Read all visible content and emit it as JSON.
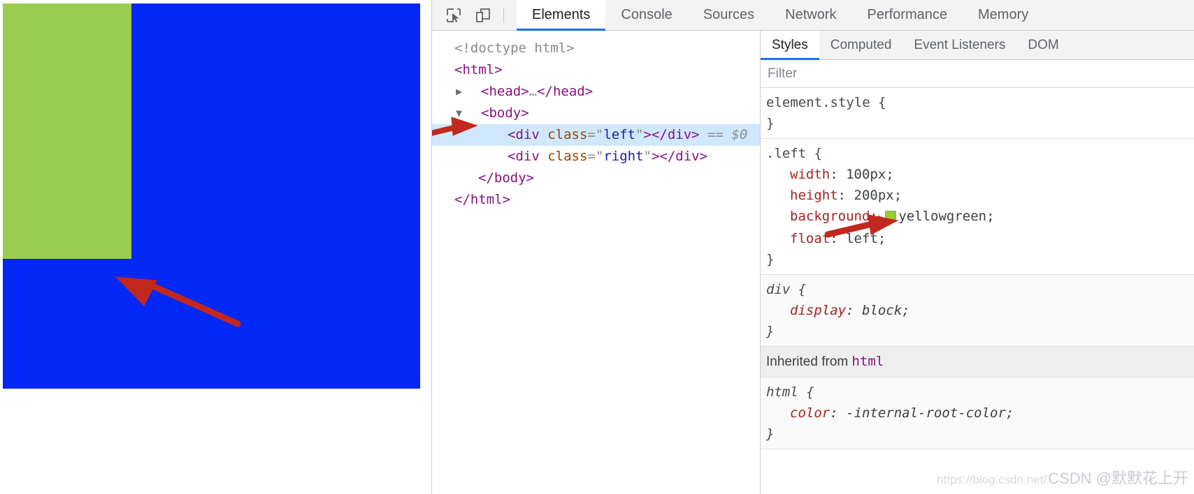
{
  "viewport": {
    "left_box": {
      "name": "left",
      "color": "#9ACD4E",
      "color_name": "yellowgreen"
    },
    "right_box": {
      "name": "right",
      "color": "#0327F5",
      "color_name": "blue"
    },
    "annotation_arrow_color": "#C2281E"
  },
  "toolbar": {
    "inspect_icon": "inspect-element-icon",
    "device_icon": "device-toolbar-icon",
    "tabs": [
      {
        "label": "Elements",
        "active": true
      },
      {
        "label": "Console",
        "active": false
      },
      {
        "label": "Sources",
        "active": false
      },
      {
        "label": "Network",
        "active": false
      },
      {
        "label": "Performance",
        "active": false
      },
      {
        "label": "Memory",
        "active": false
      }
    ]
  },
  "dom_tree": {
    "lines": [
      {
        "type": "doctype",
        "text": "<!doctype html>"
      },
      {
        "type": "open_tag",
        "tag": "html"
      },
      {
        "type": "collapsed",
        "tag": "head",
        "twisty": "▶",
        "ellipsis": "…"
      },
      {
        "type": "open_tag_expanded",
        "tag": "body",
        "twisty": "▼"
      },
      {
        "type": "element",
        "tag": "div",
        "attr": "class",
        "value": "left",
        "selected": true,
        "suffix": "== $0"
      },
      {
        "type": "element",
        "tag": "div",
        "attr": "class",
        "value": "right",
        "selected": false,
        "suffix": ""
      },
      {
        "type": "close_tag",
        "tag": "body"
      },
      {
        "type": "close_tag",
        "tag": "html"
      }
    ]
  },
  "styles_panel": {
    "tabs": [
      {
        "label": "Styles",
        "active": true
      },
      {
        "label": "Computed",
        "active": false
      },
      {
        "label": "Event Listeners",
        "active": false
      },
      {
        "label": "DOM",
        "active": false
      }
    ],
    "filter": {
      "placeholder": "Filter",
      "value": ""
    },
    "rules": [
      {
        "selector": "element.style",
        "ua": false,
        "declarations": []
      },
      {
        "selector": ".left",
        "ua": false,
        "declarations": [
          {
            "prop": "width",
            "value": "100px"
          },
          {
            "prop": "height",
            "value": "200px"
          },
          {
            "prop": "background",
            "value": "yellowgreen",
            "swatch": "#9ACD32",
            "expander": "▶"
          },
          {
            "prop": "float",
            "value": "left"
          }
        ]
      },
      {
        "selector": "div",
        "ua": true,
        "declarations": [
          {
            "prop": "display",
            "value": "block"
          }
        ]
      }
    ],
    "inherited_header": {
      "prefix": "Inherited from",
      "tag": "html"
    },
    "inherited_rules": [
      {
        "selector": "html",
        "ua": true,
        "declarations": [
          {
            "prop": "color",
            "value": "-internal-root-color"
          }
        ]
      }
    ]
  },
  "watermark": {
    "url": "https://blog.csdn.net/",
    "brand": "CSDN @默默花上开"
  }
}
